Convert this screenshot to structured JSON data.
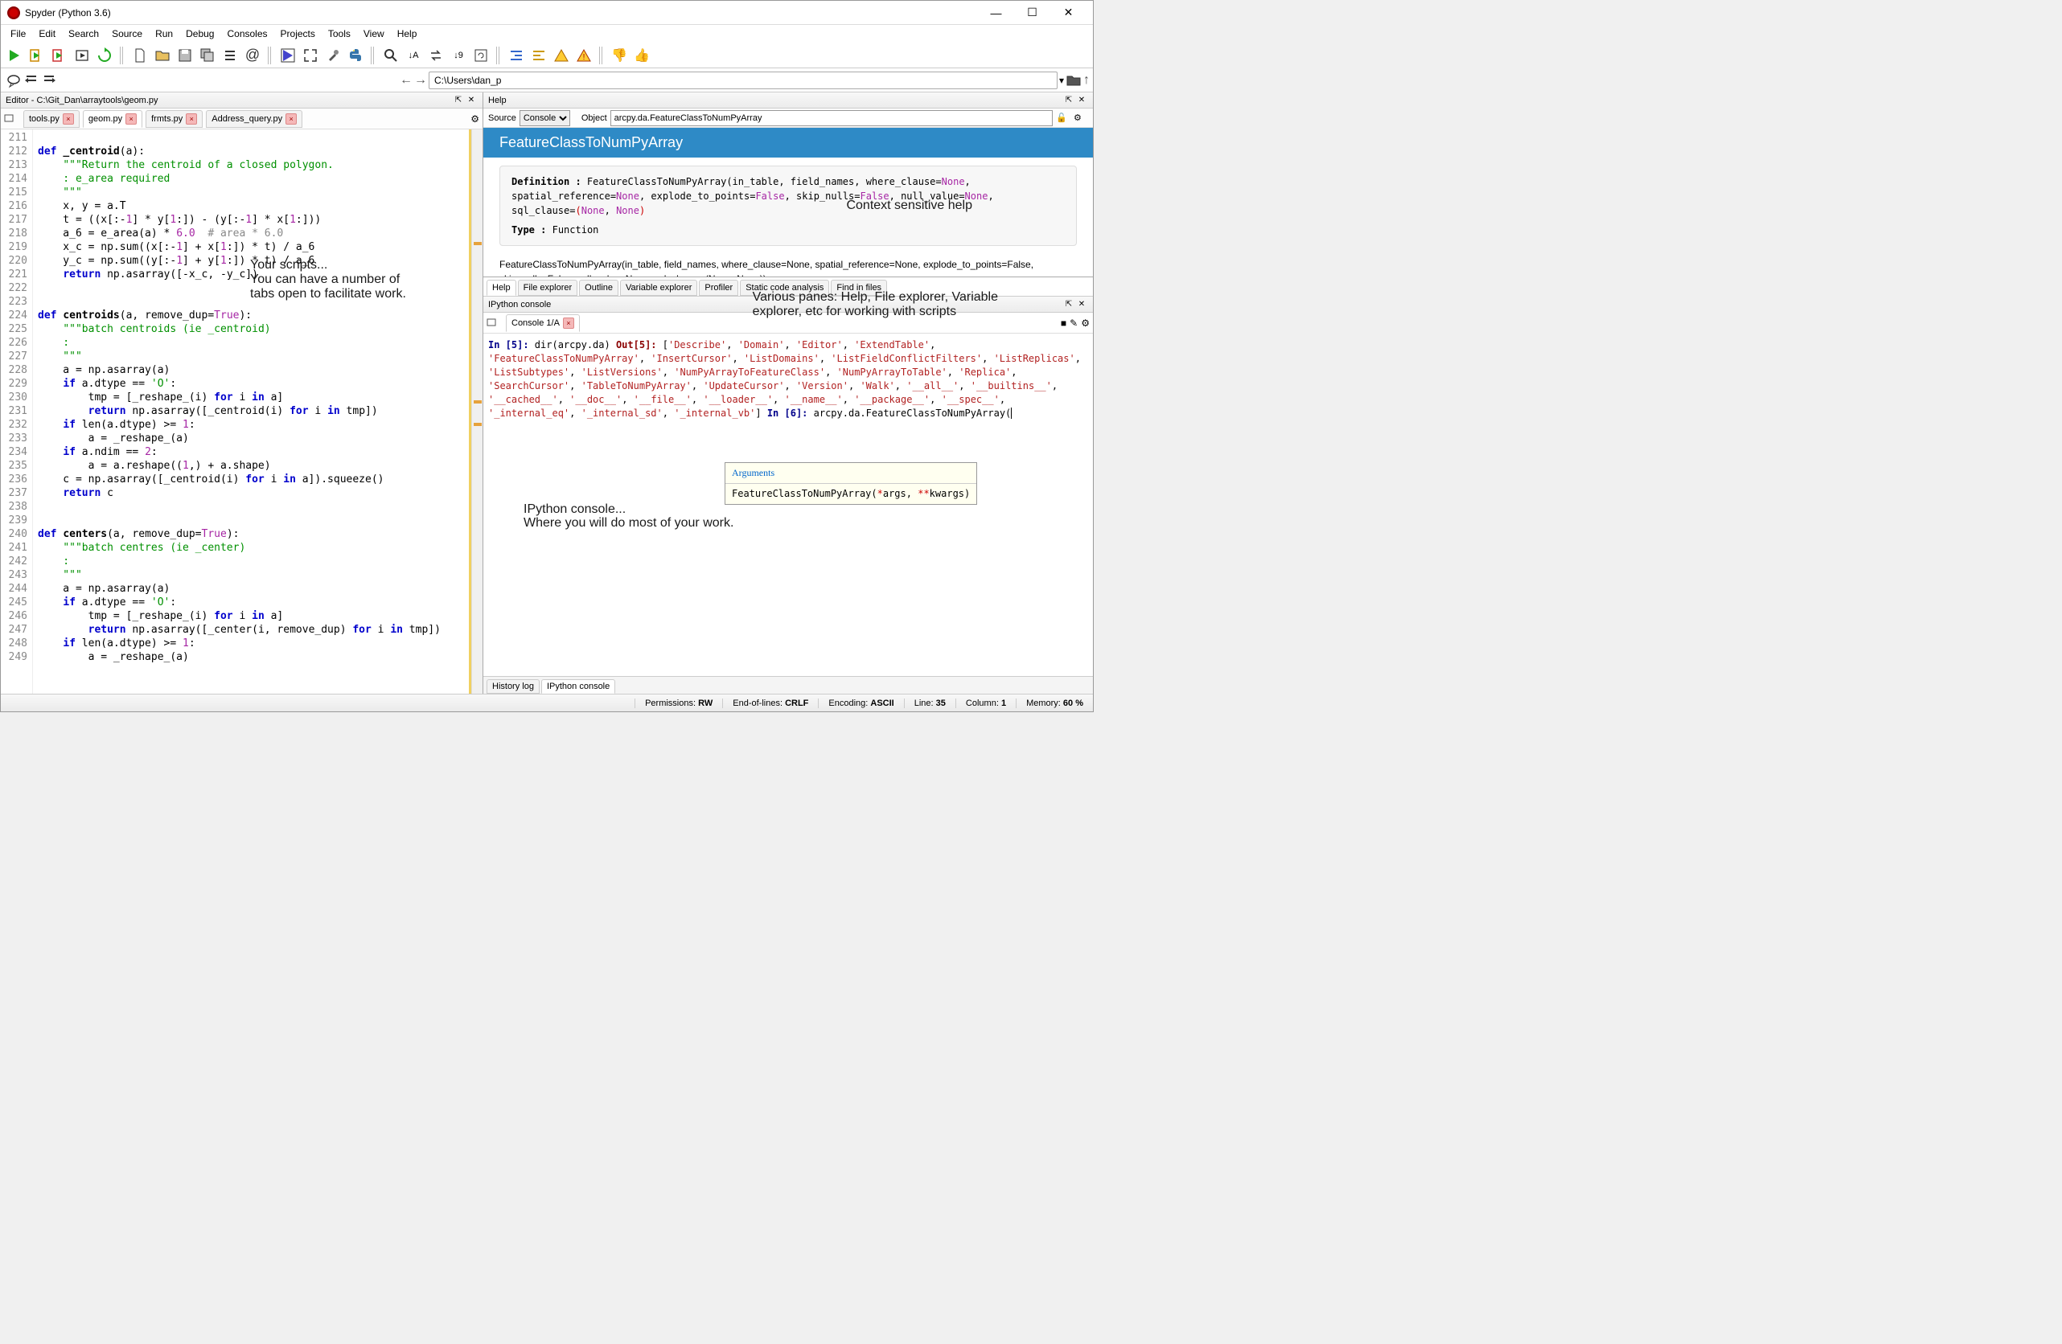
{
  "window": {
    "title": "Spyder (Python 3.6)"
  },
  "menu": [
    "File",
    "Edit",
    "Search",
    "Source",
    "Run",
    "Debug",
    "Consoles",
    "Projects",
    "Tools",
    "View",
    "Help"
  ],
  "pathbox": "C:\\Users\\dan_p",
  "editor": {
    "title": "Editor - C:\\Git_Dan\\arraytools\\geom.py",
    "tabs": [
      {
        "label": "tools.py",
        "active": false
      },
      {
        "label": "geom.py",
        "active": true
      },
      {
        "label": "frmts.py",
        "active": false
      },
      {
        "label": "Address_query.py",
        "active": false
      }
    ],
    "lines_start": 211,
    "lines_end": 249
  },
  "help": {
    "title": "Help",
    "source": "Console",
    "object": "arcpy.da.FeatureClassToNumPyArray",
    "banner": "FeatureClassToNumPyArray",
    "def_label": "Definition :",
    "type_label": "Type :",
    "type_value": "Function",
    "tabs": [
      "Help",
      "File explorer",
      "Outline",
      "Variable explorer",
      "Profiler",
      "Static code analysis",
      "Find in files"
    ]
  },
  "ipython": {
    "title": "IPython console",
    "tab": "Console 1/A",
    "tooltip_hdr": "Arguments",
    "tooltip_body": "FeatureClassToNumPyArray("
  },
  "annotations": {
    "scripts": "Your scripts...\nYou can have a number of\ntabs open to facilitate work.",
    "helpnote": "Context sensitive help",
    "panes": "Various panes: Help, File explorer, Variable\nexplorer, etc for working with scripts",
    "console": "IPython console...\nWhere you will do most of your work."
  },
  "bottom_tabs": [
    "History log",
    "IPython console"
  ],
  "status": {
    "perm_label": "Permissions:",
    "perm": "RW",
    "eol_label": "End-of-lines:",
    "eol": "CRLF",
    "enc_label": "Encoding:",
    "enc": "ASCII",
    "line_label": "Line:",
    "line": "35",
    "col_label": "Column:",
    "col": "1",
    "mem_label": "Memory:",
    "mem": "60 %"
  }
}
